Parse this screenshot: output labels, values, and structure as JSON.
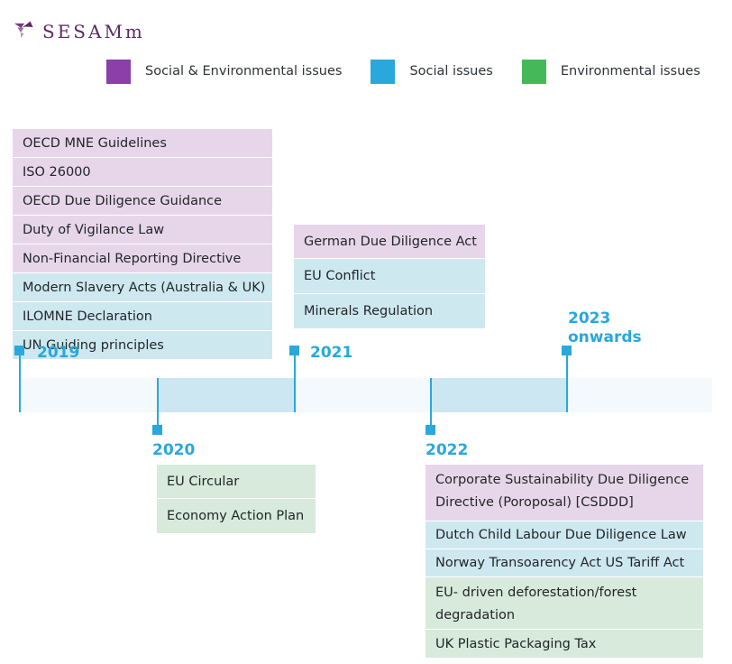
{
  "brand": {
    "name": "SESAMm",
    "logo_icon": "sesamm-bird-logo",
    "color": "#5B2B63"
  },
  "legend": {
    "items": [
      {
        "label": "Social & Environmental issues",
        "color": "#8B3FA8",
        "key": "both"
      },
      {
        "label": "Social issues",
        "color": "#29A8DC",
        "key": "social"
      },
      {
        "label": "Environmental issues",
        "color": "#45B85A",
        "key": "environmental"
      }
    ]
  },
  "timeline": {
    "axis_color": "#29A8DC",
    "bar_base_color": "#F3F9FC",
    "bar_alt_color": "#CDE7F2",
    "years": [
      {
        "label": "2019",
        "position": "above"
      },
      {
        "label": "2020",
        "position": "below"
      },
      {
        "label": "2021",
        "position": "above"
      },
      {
        "label": "2022",
        "position": "below"
      },
      {
        "label": "2023\nonwards",
        "position": "above"
      }
    ]
  },
  "blocks": {
    "y2019": {
      "year": "2019",
      "items": [
        {
          "text": "OECD MNE Guidelines",
          "category": "both"
        },
        {
          "text": "ISO 26000",
          "category": "both"
        },
        {
          "text": "OECD Due Diligence Guidance",
          "category": "both"
        },
        {
          "text": "Duty of Vigilance Law",
          "category": "both"
        },
        {
          "text": "Non-Financial Reporting Directive",
          "category": "both"
        },
        {
          "text": "Modern Slavery Acts (Australia & UK)",
          "category": "social"
        },
        {
          "text": "ILOMNE Declaration",
          "category": "social"
        },
        {
          "text": "UN Guiding principles",
          "category": "social"
        }
      ]
    },
    "y2021": {
      "year": "2021",
      "items": [
        {
          "text": "German Due Diligence Act",
          "category": "both"
        },
        {
          "text": "EU Conflict",
          "category": "social"
        },
        {
          "text": "Minerals Regulation",
          "category": "social"
        }
      ]
    },
    "y2020": {
      "year": "2020",
      "items": [
        {
          "text": "EU Circular",
          "category": "environmental"
        },
        {
          "text": "Economy Action Plan",
          "category": "environmental"
        }
      ]
    },
    "y2022": {
      "year": "2022",
      "items": [
        {
          "text": "Corporate Sustainability Due Diligence Directive (Poroposal) [CSDDD]",
          "category": "both"
        },
        {
          "text": "Dutch Child Labour Due Diligence Law",
          "category": "social"
        },
        {
          "text": "Norway Transoarency Act US Tariff Act",
          "category": "social"
        },
        {
          "text": "EU- driven deforestation/forest degradation",
          "category": "environmental"
        },
        {
          "text": "UK Plastic Packaging Tax",
          "category": "environmental"
        }
      ]
    }
  }
}
